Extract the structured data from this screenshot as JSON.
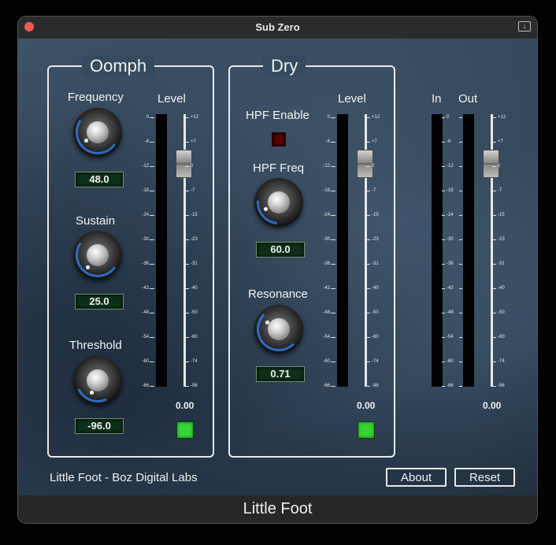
{
  "window": {
    "title": "Sub Zero",
    "footer": "Little Foot"
  },
  "icons": {
    "close": "close-button",
    "toolbar": "window-menu-icon"
  },
  "colors": {
    "accent_blue": "#2f74d6",
    "led_green": "#38d438",
    "led_red": "#5a0000",
    "value_bg": "#0d2f17"
  },
  "oomph": {
    "title": "Oomph",
    "level_label": "Level",
    "frequency": {
      "label": "Frequency",
      "value": "48.0"
    },
    "sustain": {
      "label": "Sustain",
      "value": "25.0"
    },
    "threshold": {
      "label": "Threshold",
      "value": "-96.0"
    },
    "level_value": "0.00"
  },
  "dry": {
    "title": "Dry",
    "level_label": "Level",
    "hpf_enable": {
      "label": "HPF Enable"
    },
    "hpf_freq": {
      "label": "HPF Freq",
      "value": "60.0"
    },
    "resonance": {
      "label": "Resonance",
      "value": "0.71"
    },
    "level_value": "0.00"
  },
  "output": {
    "in_label": "In",
    "out_label": "Out",
    "level_value": "0.00"
  },
  "meter_scale": [
    "0",
    "-6",
    "-12",
    "-18",
    "-24",
    "-30",
    "-36",
    "-42",
    "-48",
    "-54",
    "-60",
    "-66"
  ],
  "fader_scale": [
    "+12",
    "+7",
    "0",
    "-7",
    "-15",
    "-23",
    "-31",
    "-40",
    "-50",
    "-60",
    "-74",
    "-96"
  ],
  "credit": "Little Foot - Boz Digital Labs",
  "buttons": {
    "about": "About",
    "reset": "Reset"
  }
}
